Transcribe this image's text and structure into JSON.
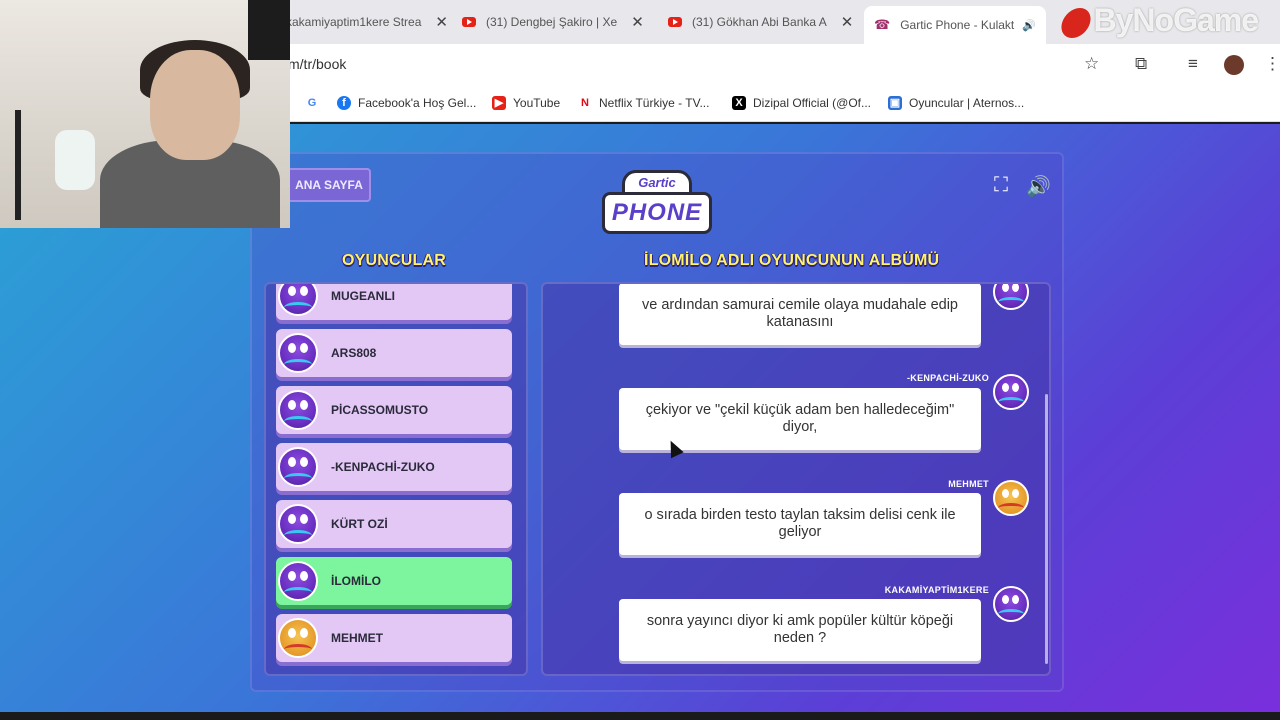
{
  "browser": {
    "tabs": [
      {
        "title": "kakamiyaptim1kere Strea",
        "active": false
      },
      {
        "title": "(31) Dengbej Şakiro | Xe",
        "active": false
      },
      {
        "title": "(31) Gökhan Abi Banka A",
        "active": false
      },
      {
        "title": "Gartic Phone - Kulakt",
        "active": true
      }
    ],
    "url": "m/tr/book",
    "bookmarks": [
      {
        "label": "Facebook'a Hoş Gel...",
        "icon": "facebook-icon"
      },
      {
        "label": "YouTube",
        "icon": "youtube-icon"
      },
      {
        "label": "Netflix Türkiye - TV...",
        "icon": "netflix-icon"
      },
      {
        "label": "Dizipal Official (@Of...",
        "icon": "x-icon"
      },
      {
        "label": "Oyuncular | Aternos...",
        "icon": "aternos-icon"
      }
    ]
  },
  "watermark": "ByNoGame",
  "game": {
    "home_label": "ANA SAYFA",
    "logo_top": "Gartic",
    "logo_bottom": "PHONE",
    "players_heading": "OYUNCULAR",
    "album_heading": "İLOMİLO ADLI OYUNCUNUN ALBÜMÜ",
    "players": [
      {
        "name": "MUGEANLI",
        "avatar": "ghost",
        "active": false
      },
      {
        "name": "ARS808",
        "avatar": "ghost",
        "active": false
      },
      {
        "name": "PİCASSOMUSTO",
        "avatar": "ghost",
        "active": false
      },
      {
        "name": "-KENPACHİ-ZUKO",
        "avatar": "ghost",
        "active": false
      },
      {
        "name": "KÜRT OZİ",
        "avatar": "ghost",
        "active": false
      },
      {
        "name": "İLOMİLO",
        "avatar": "ghost",
        "active": true
      },
      {
        "name": "MEHMET",
        "avatar": "pizza",
        "active": false
      }
    ],
    "album": [
      {
        "author": "",
        "text": "ve ardından samurai cemile olaya mudahale edip katanasını",
        "avatar": "ghost"
      },
      {
        "author": "-KENPACHİ-ZUKO",
        "text": "çekiyor ve \"çekil küçük adam ben halledeceğim\" diyor,",
        "avatar": "ghost"
      },
      {
        "author": "MEHMET",
        "text": "o sırada birden testo taylan taksim delisi cenk ile geliyor",
        "avatar": "pizza"
      },
      {
        "author": "KAKAMİYAPTİM1KERE",
        "text": "sonra yayıncı diyor ki amk popüler kültür köpeği neden ?",
        "avatar": "ghost"
      }
    ]
  }
}
